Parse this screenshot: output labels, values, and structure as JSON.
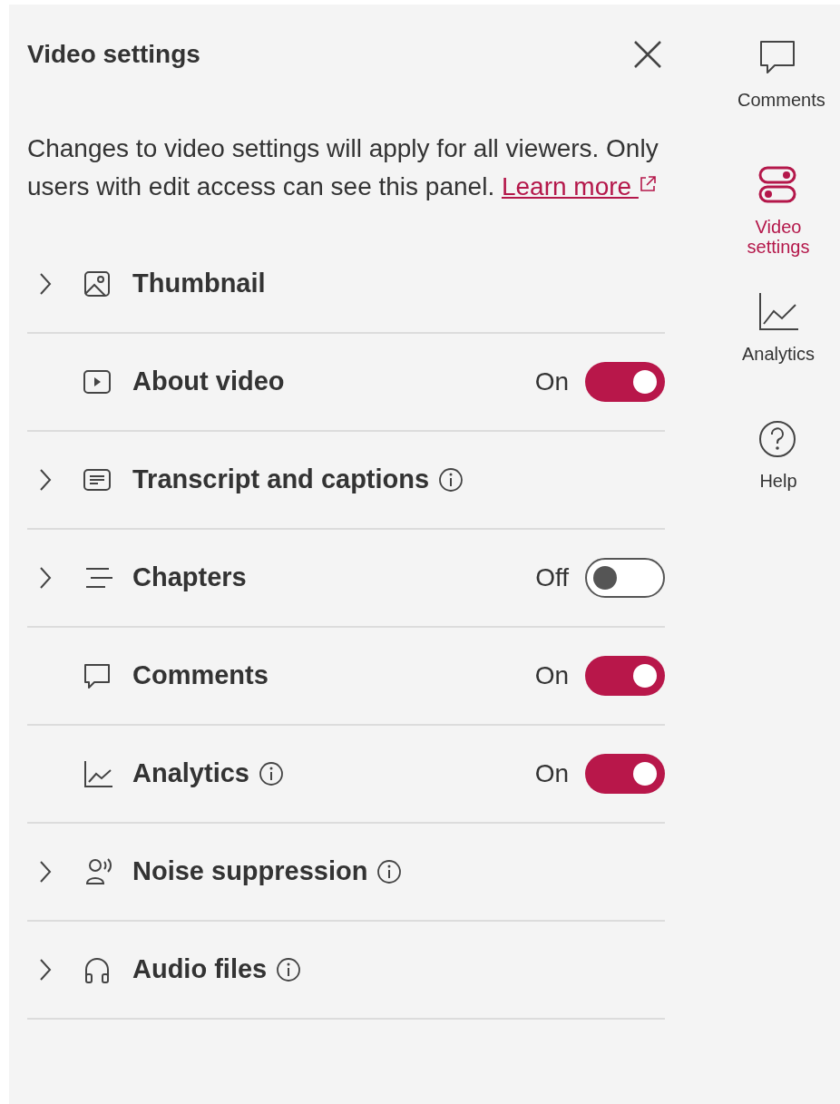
{
  "panel": {
    "title": "Video settings",
    "description": "Changes to video settings will apply for all viewers. Only users with edit access can see this panel.",
    "link": "Learn more"
  },
  "settings": [
    {
      "label": "Thumbnail",
      "expandable": true,
      "info": false
    },
    {
      "label": "About video",
      "expandable": false,
      "info": false,
      "toggle": {
        "label": "On",
        "on": true
      }
    },
    {
      "label": "Transcript and captions",
      "expandable": true,
      "info": true
    },
    {
      "label": "Chapters",
      "expandable": true,
      "info": false,
      "toggle": {
        "label": "Off",
        "on": false
      }
    },
    {
      "label": "Comments",
      "expandable": false,
      "info": false,
      "toggle": {
        "label": "On",
        "on": true
      }
    },
    {
      "label": "Analytics",
      "expandable": false,
      "info": true,
      "toggle": {
        "label": "On",
        "on": true
      }
    },
    {
      "label": "Noise suppression",
      "expandable": true,
      "info": true
    },
    {
      "label": "Audio files",
      "expandable": true,
      "info": true
    }
  ],
  "rail": [
    {
      "label": "Comments",
      "selected": false
    },
    {
      "label": "Video settings",
      "selected": true
    },
    {
      "label": "Analytics",
      "selected": false
    },
    {
      "label": "Help",
      "selected": false
    }
  ]
}
